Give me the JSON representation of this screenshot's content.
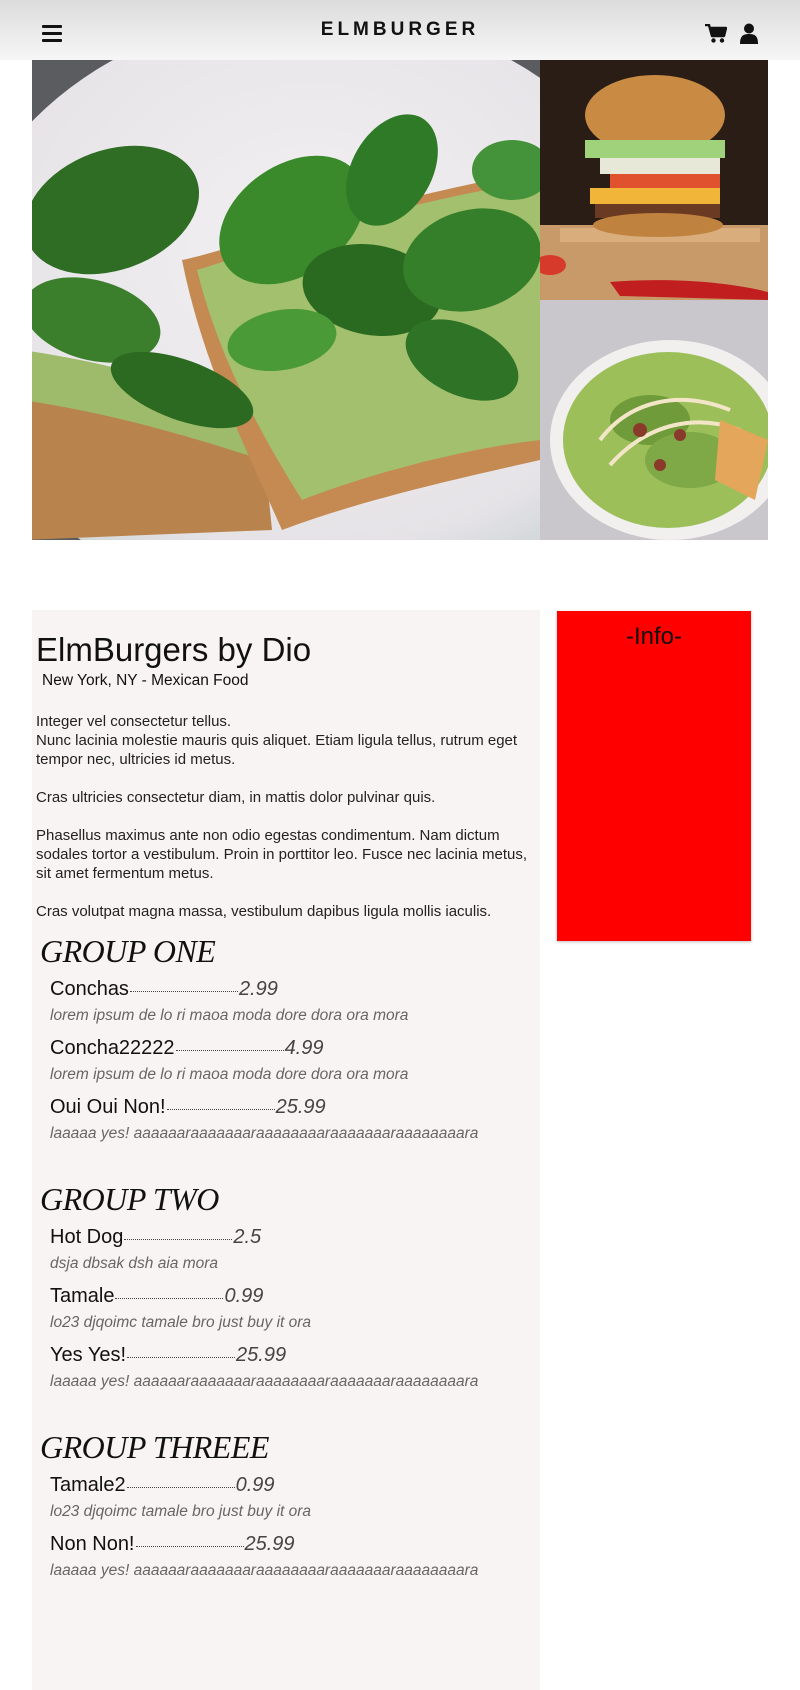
{
  "header": {
    "brand": "ELMBURGER",
    "icons": [
      "menu-icon",
      "cart-icon",
      "user-icon"
    ]
  },
  "hero": {
    "images": [
      "avocado-toast-photo",
      "burger-photo",
      "salad-photo"
    ]
  },
  "restaurant": {
    "name": "ElmBurgers by Dio",
    "subtitle": "New York, NY - Mexican Food",
    "intro": [
      "Integer vel consectetur tellus.\nNunc lacinia molestie mauris quis aliquet. Etiam ligula tellus, rutrum eget tempor nec, ultricies id metus.",
      "Cras ultricies consectetur diam, in mattis dolor pulvinar quis.",
      "Phasellus maximus ante non odio egestas condimentum. Nam dictum sodales tortor a vestibulum. Proin in porttitor leo. Fusce nec lacinia metus, sit amet fermentum metus.",
      "Cras volutpat magna massa, vestibulum dapibus ligula mollis iaculis."
    ]
  },
  "menu": {
    "groups": [
      {
        "title": "GROUP ONE",
        "items": [
          {
            "name": "Conchas",
            "price": "2.99",
            "desc": "lorem ipsum de lo ri maoa moda dore dora ora mora"
          },
          {
            "name": "Concha22222",
            "price": "4.99",
            "desc": "lorem ipsum de lo ri maoa moda dore dora ora mora"
          },
          {
            "name": "Oui Oui Non!",
            "price": "25.99",
            "desc": "laaaaa yes! aaaaaaraaaaaaaraaaaaaaaraaaaaaaraaaaaaaara"
          }
        ]
      },
      {
        "title": "GROUP TWO",
        "items": [
          {
            "name": "Hot Dog",
            "price": "2.5",
            "desc": "dsja dbsak dsh aia mora"
          },
          {
            "name": "Tamale",
            "price": "0.99",
            "desc": "lo23 djqoimc tamale bro just buy it ora"
          },
          {
            "name": "Yes Yes!",
            "price": "25.99",
            "desc": "laaaaa yes! aaaaaaraaaaaaaraaaaaaaaraaaaaaaraaaaaaaara"
          }
        ]
      },
      {
        "title": "GROUP THREEE",
        "items": [
          {
            "name": "Tamale2",
            "price": "0.99",
            "desc": "lo23 djqoimc tamale bro just buy it ora"
          },
          {
            "name": "Non Non!",
            "price": "25.99",
            "desc": "laaaaa yes! aaaaaaraaaaaaaraaaaaaaaraaaaaaaraaaaaaaara"
          }
        ]
      }
    ]
  },
  "info": {
    "title": "-Info-",
    "background": "#ff0000"
  }
}
